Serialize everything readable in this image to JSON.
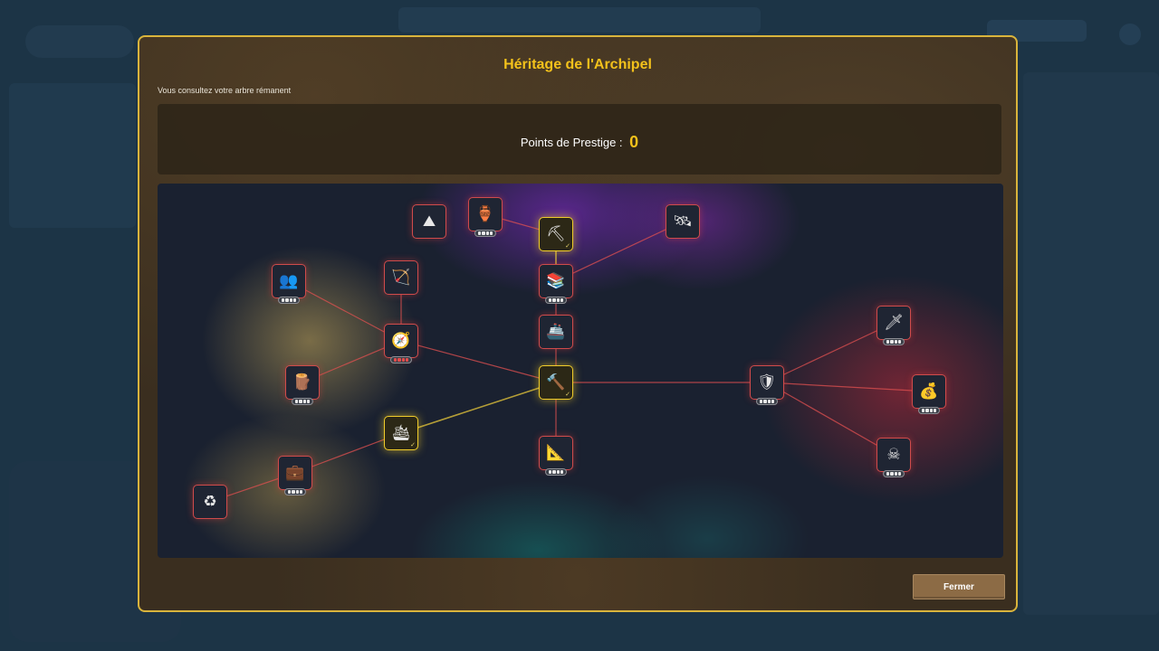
{
  "modal": {
    "title": "Héritage de l'Archipel",
    "subtitle": "Vous consultez votre arbre rémanent",
    "prestige_label": "Points de Prestige :",
    "prestige_value": "0",
    "close_label": "Fermer"
  },
  "colors": {
    "accent_gold": "#f3c11b",
    "node_border": "#d04b4b",
    "owned_border": "#f0cc2a"
  },
  "nodes": [
    {
      "id": "mountain",
      "icon": "mountain-icon",
      "glyph": "⛰",
      "owned": false,
      "level": false
    },
    {
      "id": "vase",
      "icon": "vase-icon",
      "glyph": "🏺",
      "owned": false,
      "level": true
    },
    {
      "id": "pickaxe",
      "icon": "pickaxe-icon",
      "glyph": "⛏",
      "owned": true,
      "level": false
    },
    {
      "id": "satellite",
      "icon": "satellite-icon",
      "glyph": "🛰",
      "owned": false,
      "level": false
    },
    {
      "id": "books",
      "icon": "books-icon",
      "glyph": "📚",
      "owned": false,
      "level": true
    },
    {
      "id": "ship",
      "icon": "ship-icon",
      "glyph": "🚢",
      "owned": false,
      "level": false
    },
    {
      "id": "hammer",
      "icon": "hammer-icon",
      "glyph": "🔨",
      "owned": true,
      "level": false
    },
    {
      "id": "set-square",
      "icon": "set-square-icon",
      "glyph": "📐",
      "owned": false,
      "level": true
    },
    {
      "id": "people",
      "icon": "people-icon",
      "glyph": "👥",
      "owned": false,
      "level": true
    },
    {
      "id": "bow",
      "icon": "bow-icon",
      "glyph": "🏹",
      "owned": false,
      "level": false
    },
    {
      "id": "compass",
      "icon": "compass-icon",
      "glyph": "🧭",
      "owned": false,
      "level": true,
      "level_red": true
    },
    {
      "id": "wood",
      "icon": "wood-log-icon",
      "glyph": "🪵",
      "owned": false,
      "level": true
    },
    {
      "id": "cargo-ship",
      "icon": "cargo-ship-icon",
      "glyph": "🛳",
      "owned": true,
      "level": false
    },
    {
      "id": "briefcase",
      "icon": "briefcase-icon",
      "glyph": "💼",
      "owned": false,
      "level": true
    },
    {
      "id": "recycle",
      "icon": "recycle-icon",
      "glyph": "♻",
      "owned": false,
      "level": false
    },
    {
      "id": "shield",
      "icon": "shield-icon",
      "glyph": "🛡",
      "owned": false,
      "level": true
    },
    {
      "id": "dagger",
      "icon": "dagger-icon",
      "glyph": "🗡",
      "owned": false,
      "level": true
    },
    {
      "id": "money-bag",
      "icon": "money-bag-icon",
      "glyph": "💰",
      "owned": false,
      "level": true
    },
    {
      "id": "pirate",
      "icon": "pirate-flag-icon",
      "glyph": "☠",
      "owned": false,
      "level": true
    }
  ]
}
